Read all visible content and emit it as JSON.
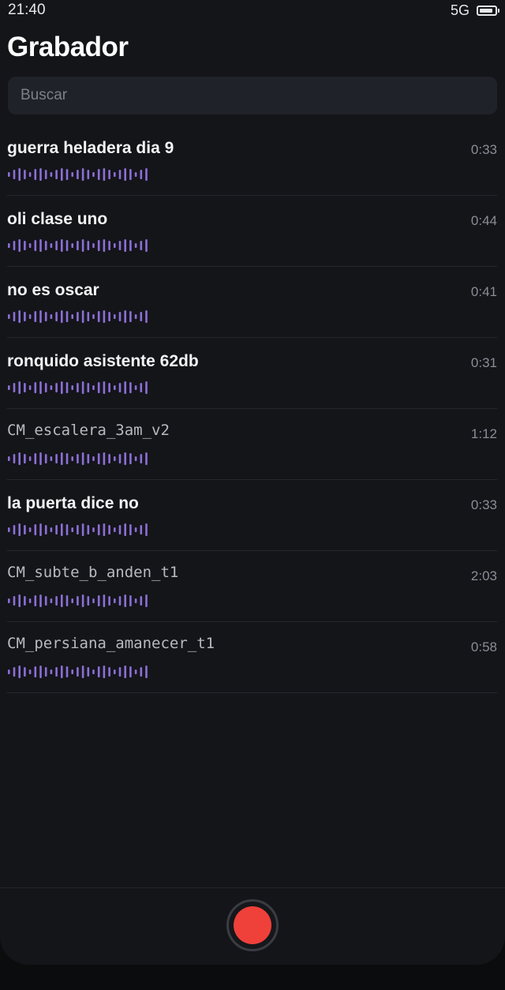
{
  "status": {
    "time": "21:40",
    "network": "5G",
    "battery_icon": "battery-icon"
  },
  "app": {
    "title": "Grabador"
  },
  "search": {
    "placeholder": "Buscar",
    "value": ""
  },
  "recordings": [
    {
      "title": "guerra heladera dia 9",
      "duration": "0:33",
      "style": "bold"
    },
    {
      "title": "oli clase uno",
      "duration": "0:44",
      "style": "bold"
    },
    {
      "title": "no es oscar",
      "duration": "0:41",
      "style": "bold"
    },
    {
      "title": "ronquido asistente 62db",
      "duration": "0:31",
      "style": "bold"
    },
    {
      "title": "CM_escalera_3am_v2",
      "duration": "1:12",
      "style": "mono"
    },
    {
      "title": "la puerta dice no",
      "duration": "0:33",
      "style": "bold"
    },
    {
      "title": "CM_subte_b_anden_t1",
      "duration": "2:03",
      "style": "mono"
    },
    {
      "title": "CM_persiana_amanecer_t1",
      "duration": "0:58",
      "style": "mono"
    }
  ],
  "waveform_icon": "waveform-icon",
  "record_icon": "record-icon",
  "colors": {
    "background": "#141519",
    "waveform": "#8c6fd6",
    "record": "#f0403a",
    "search_bg": "#1f2229"
  }
}
